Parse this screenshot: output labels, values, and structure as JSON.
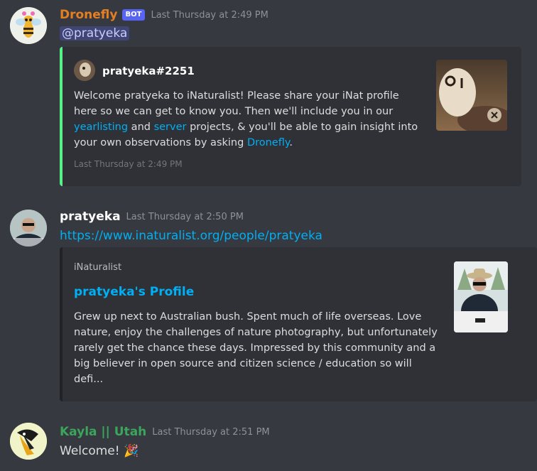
{
  "colors": {
    "background": "#36393f",
    "embed_bg": "#2f3136",
    "dronefly_name": "#e67e22",
    "pratyeka_name": "#ffffff",
    "kayla_name": "#3ba55c",
    "link": "#00aff4",
    "embed_border_green": "#57f287",
    "bot_badge": "#5865f2"
  },
  "messages": [
    {
      "author": "Dronefly",
      "badge": "BOT",
      "timestamp": "Last Thursday at 2:49 PM",
      "mention": "@pratyeka",
      "embed": {
        "author": "pratyeka#2251",
        "lines": [
          "Welcome pratyeka to iNaturalist! Please share your iNat profile",
          "here so we can get to know you. Then we'll include you in our"
        ],
        "line3_link1": "yearlisting",
        "line3_mid": " and ",
        "line3_link2": "server",
        "line3_end": " projects, & you'll be able to gain insight into",
        "line4_start": "your own observations by asking ",
        "line4_link": "Dronefly",
        "line4_end": ".",
        "footer": "Last Thursday at 2:49 PM"
      }
    },
    {
      "author": "pratyeka",
      "timestamp": "Last Thursday at 2:50 PM",
      "link": "https://www.inaturalist.org/people/pratyeka",
      "embed": {
        "provider": "iNaturalist",
        "title": "pratyeka's Profile",
        "lines": [
          "Grew up next to Australian bush. Spent much of life overseas. Love",
          "nature, enjoy the challenges of nature photography, but unfortunately",
          "rarely get the chance these days. Impressed by this community and a",
          "big believer in open source and citizen science / education so will",
          "defi..."
        ]
      }
    },
    {
      "author": "Kayla || Utah",
      "timestamp": "Last Thursday at 2:51 PM",
      "text": "Welcome! ",
      "emoji": "🎉"
    }
  ]
}
